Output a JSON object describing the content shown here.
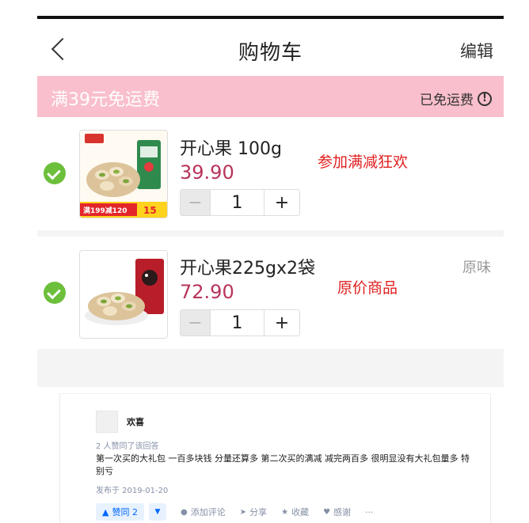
{
  "header": {
    "back_icon": "chevron-left-icon",
    "title": "购物车",
    "edit_label": "编辑"
  },
  "promo": {
    "text": "满39元免运费",
    "status": "已免运费",
    "info_icon_glyph": "!",
    "background": "#f9bfcc"
  },
  "cart": {
    "items": [
      {
        "name": "开心果 100g",
        "price": "39.90",
        "quantity": "1",
        "minus": "−",
        "plus": "+",
        "annotation": "参加满减狂欢",
        "thumb_banner": "满199减120",
        "thumb_badge": "15"
      },
      {
        "name": "开心果225gx2袋",
        "price": "72.90",
        "quantity": "1",
        "minus": "−",
        "plus": "+",
        "annotation": "原价商品",
        "variant": "原味"
      }
    ],
    "price_color": "#b8345a",
    "check_color": "#6cbf3a",
    "annotation_color": "#e02020"
  },
  "comment": {
    "user": "欢喜",
    "likes_text": "2 人赞同了该回答",
    "body": "第一次买的大礼包 一百多块钱 分量还算多 第二次买的满减 减完两百多 很明显没有大礼包量多 特别亏",
    "date": "发布于 2019-01-20",
    "actions": {
      "upvote": "赞同 2",
      "add_comment": "添加评论",
      "share": "分享",
      "collect": "收藏",
      "thanks": "感谢",
      "more": "···"
    },
    "link_color": "#0066ff"
  }
}
